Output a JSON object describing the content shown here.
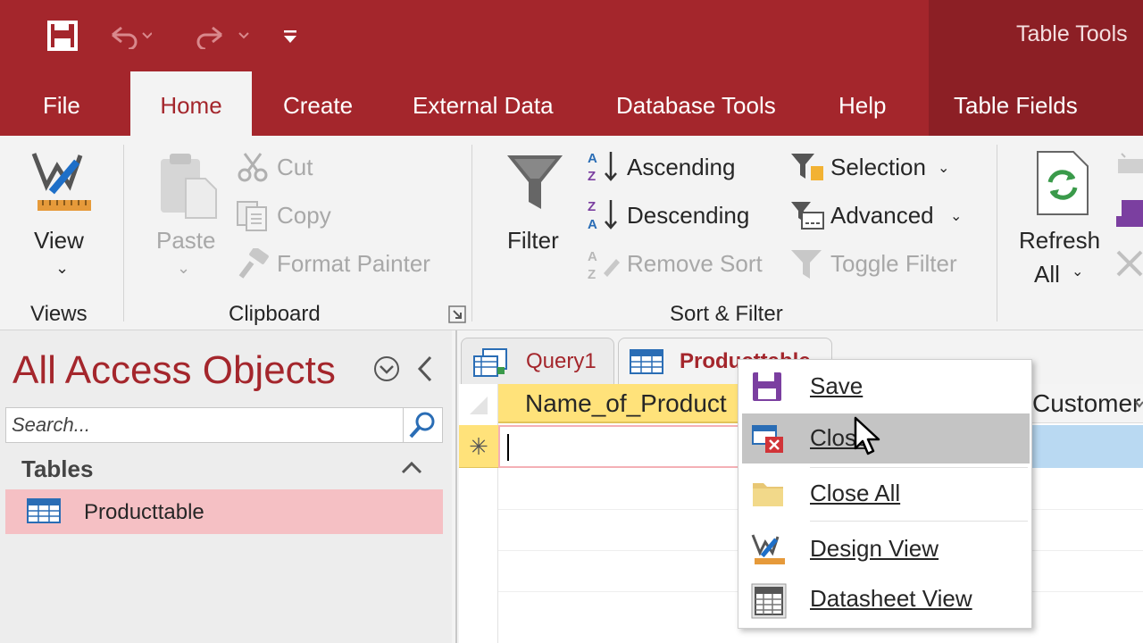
{
  "quick_access": {
    "save_icon": "save-icon",
    "undo_icon": "undo-icon",
    "redo_icon": "redo-icon",
    "customize_icon": "customize-qat-icon"
  },
  "contextual_title": "Table Tools",
  "tabs": [
    {
      "label": "File"
    },
    {
      "label": "Home",
      "active": true
    },
    {
      "label": "Create"
    },
    {
      "label": "External Data"
    },
    {
      "label": "Database Tools"
    },
    {
      "label": "Help"
    },
    {
      "label": "Table Fields"
    }
  ],
  "ribbon": {
    "views": {
      "view_label": "View",
      "group_label": "Views"
    },
    "clipboard": {
      "paste_label": "Paste",
      "cut_label": "Cut",
      "copy_label": "Copy",
      "format_painter_label": "Format Painter",
      "group_label": "Clipboard"
    },
    "sort_filter": {
      "filter_label": "Filter",
      "ascending_label": "Ascending",
      "descending_label": "Descending",
      "remove_sort_label": "Remove Sort",
      "selection_label": "Selection",
      "advanced_label": "Advanced",
      "toggle_filter_label": "Toggle Filter",
      "group_label": "Sort & Filter"
    },
    "records": {
      "refresh_line1": "Refresh",
      "refresh_line2": "All"
    }
  },
  "nav_pane": {
    "title": "All Access Objects",
    "search_placeholder": "Search...",
    "section_label": "Tables",
    "items": [
      {
        "label": "Producttable",
        "selected": true
      }
    ]
  },
  "document_tabs": [
    {
      "label": "Query1"
    },
    {
      "label": "Producttable",
      "active": true
    }
  ],
  "datasheet": {
    "columns": [
      "Name_of_Product",
      "Customer"
    ],
    "new_row_marker": "✳"
  },
  "context_menu": {
    "items": [
      {
        "label": "Save"
      },
      {
        "label": "Close",
        "hover": true
      },
      {
        "label": "Close All"
      },
      {
        "label": "Design View"
      },
      {
        "label": "Datasheet View"
      }
    ]
  },
  "colors": {
    "brand": "#a4262c",
    "contextual": "#8c1f25",
    "ribbon_bg": "#f3f3f3",
    "selected_nav": "#f5c0c4",
    "new_row_selector": "#ffe27a",
    "column_header_active": "#ffe27a",
    "row_highlight": "#b9d9f2"
  }
}
